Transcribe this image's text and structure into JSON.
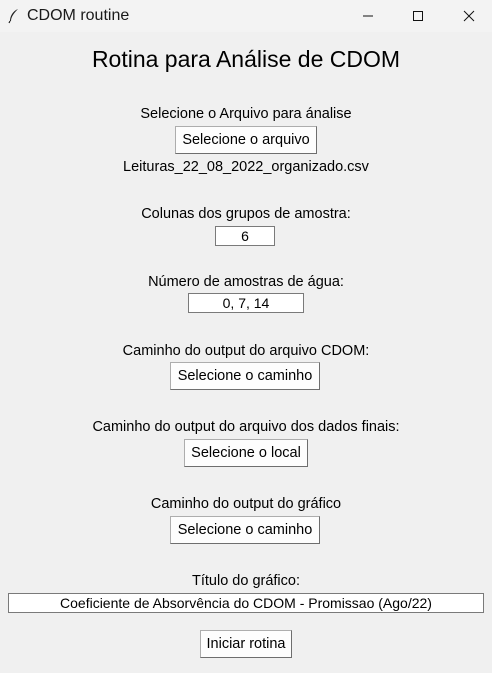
{
  "window": {
    "title": "CDOM routine"
  },
  "main": {
    "heading": "Rotina para Análise de CDOM",
    "file_prompt": "Selecione o Arquivo para ánalise",
    "file_button": "Selecione o arquivo",
    "selected_file": "Leituras_22_08_2022_organizado.csv",
    "group_columns_label": "Colunas dos grupos de amostra:",
    "group_columns_value": "6",
    "water_samples_label": "Número de amostras de água:",
    "water_samples_value": "0, 7, 14",
    "cdom_output_label": "Caminho do output do arquivo CDOM:",
    "cdom_output_button": "Selecione o caminho",
    "final_output_label": "Caminho do output do arquivo dos dados finais:",
    "final_output_button": "Selecione o local",
    "graph_output_label": "Caminho do output do gráfico",
    "graph_output_button": "Selecione o caminho",
    "graph_title_label": "Título do gráfico:",
    "graph_title_value": "Coeficiente de Absorvência do CDOM - Promissao (Ago/22)",
    "start_button": "Iniciar rotina"
  }
}
